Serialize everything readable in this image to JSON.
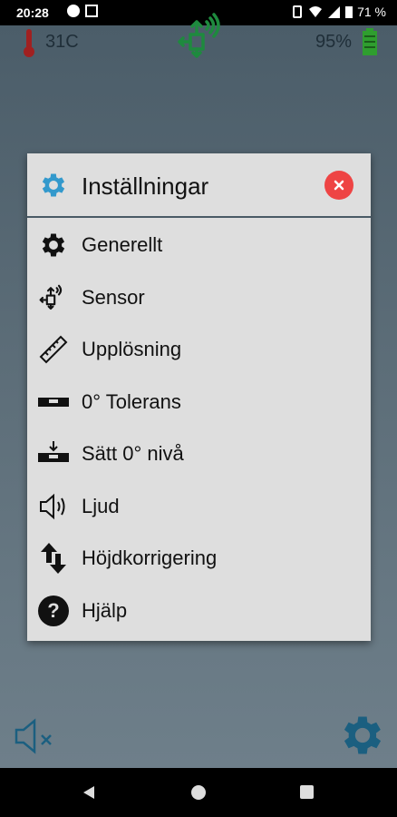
{
  "status": {
    "time": "20:28",
    "battery": "71 %"
  },
  "top": {
    "temperature": "31C",
    "battery": "95%"
  },
  "dialog": {
    "title": "Inställningar",
    "items": [
      {
        "label": "Generellt",
        "icon": "gear-icon"
      },
      {
        "label": "Sensor",
        "icon": "sensor-icon"
      },
      {
        "label": "Upplösning",
        "icon": "ruler-icon"
      },
      {
        "label": "0° Tolerans",
        "icon": "level-tolerance-icon"
      },
      {
        "label": "Sätt 0° nivå",
        "icon": "set-level-icon"
      },
      {
        "label": "Ljud",
        "icon": "speaker-icon"
      },
      {
        "label": "Höjdkorrigering",
        "icon": "height-correction-icon"
      },
      {
        "label": "Hjälp",
        "icon": "help-icon"
      }
    ]
  },
  "colors": {
    "accent": "#3399cc",
    "close": "#e44444",
    "battery": "#2f9e2f",
    "temperature": "#a02020"
  }
}
